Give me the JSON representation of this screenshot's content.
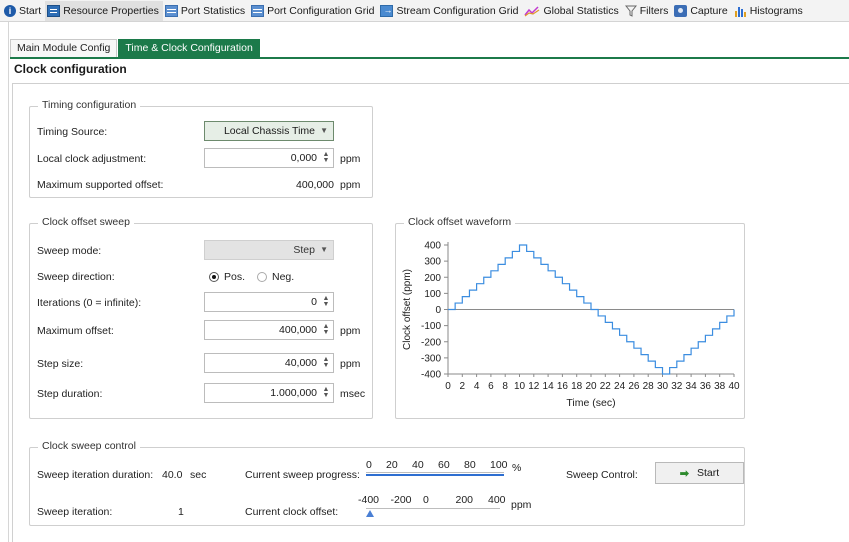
{
  "toolbar": {
    "items": [
      {
        "label": "Start",
        "icon": "info-icon"
      },
      {
        "label": "Resource Properties",
        "icon": "window-icon"
      },
      {
        "label": "Port Statistics",
        "icon": "grid-icon"
      },
      {
        "label": "Port Configuration Grid",
        "icon": "grid-icon"
      },
      {
        "label": "Stream Configuration Grid",
        "icon": "stream-icon"
      },
      {
        "label": "Global Statistics",
        "icon": "chart-line-icon"
      },
      {
        "label": "Filters",
        "icon": "filter-icon"
      },
      {
        "label": "Capture",
        "icon": "capture-icon"
      },
      {
        "label": "Histograms",
        "icon": "histogram-icon"
      }
    ]
  },
  "tabs": [
    "Main Module Config",
    "Time & Clock Configuration"
  ],
  "panel_title": "Clock configuration",
  "timing": {
    "legend": "Timing configuration",
    "source_label": "Timing Source:",
    "source_value": "Local Chassis Time",
    "adjust_label": "Local clock adjustment:",
    "adjust_value": "0,000",
    "adjust_unit": "ppm",
    "maxsup_label": "Maximum supported offset:",
    "maxsup_value": "400,000",
    "maxsup_unit": "ppm"
  },
  "sweep": {
    "legend": "Clock offset sweep",
    "mode_label": "Sweep mode:",
    "mode_value": "Step",
    "direction_label": "Sweep direction:",
    "direction_pos": "Pos.",
    "direction_neg": "Neg.",
    "iterations_label": "Iterations (0 = infinite):",
    "iterations_value": "0",
    "maxoff_label": "Maximum offset:",
    "maxoff_value": "400,000",
    "maxoff_unit": "ppm",
    "step_label": "Step size:",
    "step_value": "40,000",
    "step_unit": "ppm",
    "duration_label": "Step duration:",
    "duration_value": "1.000,000",
    "duration_unit": "msec"
  },
  "waveform": {
    "legend": "Clock offset waveform"
  },
  "chart_data": {
    "type": "line",
    "title": "",
    "xlabel": "Time (sec)",
    "ylabel": "Clock offset (ppm)",
    "xlim": [
      0,
      40
    ],
    "ylim": [
      -400,
      400
    ],
    "xticks": [
      0,
      2,
      4,
      6,
      8,
      10,
      12,
      14,
      16,
      18,
      20,
      22,
      24,
      26,
      28,
      30,
      32,
      34,
      36,
      38,
      40
    ],
    "yticks": [
      400,
      300,
      200,
      100,
      0,
      -100,
      -200,
      -300,
      -400
    ],
    "step": true,
    "x": [
      0,
      1,
      2,
      3,
      4,
      5,
      6,
      7,
      8,
      9,
      10,
      11,
      12,
      13,
      14,
      15,
      16,
      17,
      18,
      19,
      20,
      21,
      22,
      23,
      24,
      25,
      26,
      27,
      28,
      29,
      30,
      31,
      32,
      33,
      34,
      35,
      36,
      37,
      38,
      39,
      40
    ],
    "y": [
      0,
      40,
      80,
      120,
      160,
      200,
      240,
      280,
      320,
      360,
      400,
      360,
      320,
      280,
      240,
      200,
      160,
      120,
      80,
      40,
      0,
      -40,
      -80,
      -120,
      -160,
      -200,
      -240,
      -280,
      -320,
      -360,
      -400,
      -360,
      -320,
      -280,
      -240,
      -200,
      -160,
      -120,
      -80,
      -40,
      0
    ],
    "color": "#3b8de0"
  },
  "control": {
    "legend": "Clock sweep control",
    "iter_duration_label": "Sweep iteration duration:",
    "iter_duration_value": "40.0",
    "iter_duration_unit": "sec",
    "progress_label": "Current sweep progress:",
    "progress_scale": [
      "0",
      "20",
      "40",
      "60",
      "80",
      "100"
    ],
    "progress_unit": "%",
    "progress_percent": 100,
    "sweep_control_label": "Sweep Control:",
    "start_label": "Start",
    "iteration_label": "Sweep iteration:",
    "iteration_value": "1",
    "offset_label": "Current clock offset:",
    "offset_scale": [
      "-400",
      "-200",
      "0",
      "200",
      "400"
    ],
    "offset_unit": "ppm",
    "offset_value": -400
  }
}
